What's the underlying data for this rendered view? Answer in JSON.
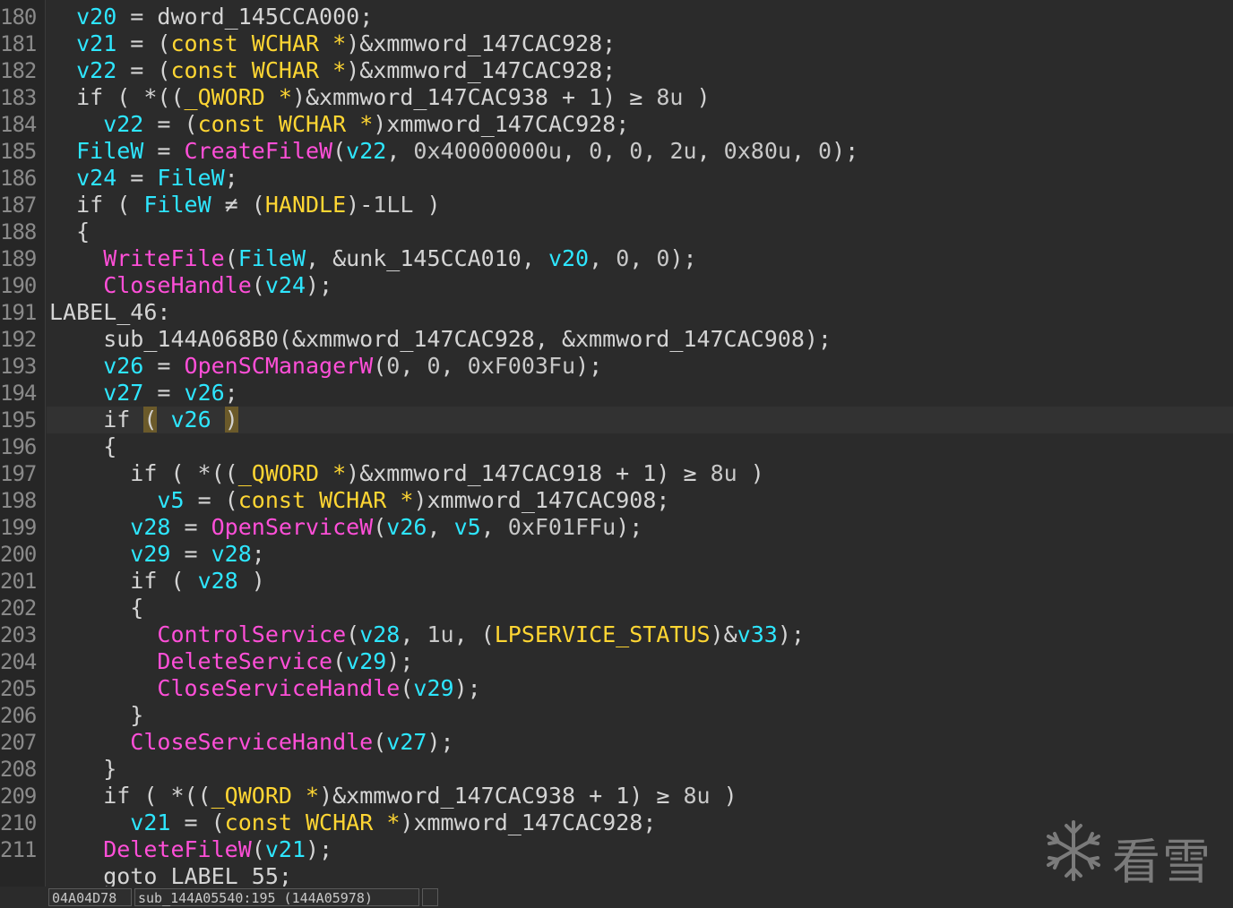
{
  "editor": {
    "current_line": 195,
    "lines": [
      {
        "n": "180",
        "indent": 1,
        "tokens": [
          [
            "v",
            "v20"
          ],
          [
            "p",
            " = "
          ],
          [
            "g",
            "dword_145CCA000"
          ],
          [
            "p",
            ";"
          ]
        ]
      },
      {
        "n": "181",
        "indent": 1,
        "tokens": [
          [
            "v",
            "v21"
          ],
          [
            "p",
            " = ("
          ],
          [
            "t",
            "const"
          ],
          [
            "p",
            " "
          ],
          [
            "t",
            "WCHAR"
          ],
          [
            "p",
            " "
          ],
          [
            "t",
            "*"
          ],
          [
            "p",
            ")&xmmword_147CAC928;"
          ]
        ]
      },
      {
        "n": "182",
        "indent": 1,
        "tokens": [
          [
            "v",
            "v22"
          ],
          [
            "p",
            " = ("
          ],
          [
            "t",
            "const"
          ],
          [
            "p",
            " "
          ],
          [
            "t",
            "WCHAR"
          ],
          [
            "p",
            " "
          ],
          [
            "t",
            "*"
          ],
          [
            "p",
            ")&xmmword_147CAC928;"
          ]
        ]
      },
      {
        "n": "183",
        "indent": 1,
        "tokens": [
          [
            "p",
            "if ( *(("
          ],
          [
            "t",
            "_QWORD"
          ],
          [
            "p",
            " "
          ],
          [
            "t",
            "*"
          ],
          [
            "p",
            ")&xmmword_147CAC938 + 1) "
          ],
          [
            "p",
            "≥"
          ],
          [
            "p",
            " "
          ],
          [
            "n",
            "8u"
          ],
          [
            "p",
            " )"
          ]
        ]
      },
      {
        "n": "184",
        "indent": 2,
        "tokens": [
          [
            "v",
            "v22"
          ],
          [
            "p",
            " = ("
          ],
          [
            "t",
            "const"
          ],
          [
            "p",
            " "
          ],
          [
            "t",
            "WCHAR"
          ],
          [
            "p",
            " "
          ],
          [
            "t",
            "*"
          ],
          [
            "p",
            ")xmmword_147CAC928;"
          ]
        ]
      },
      {
        "n": "185",
        "indent": 1,
        "tokens": [
          [
            "v",
            "FileW"
          ],
          [
            "p",
            " = "
          ],
          [
            "f",
            "CreateFileW"
          ],
          [
            "p",
            "("
          ],
          [
            "v",
            "v22"
          ],
          [
            "p",
            ", "
          ],
          [
            "n",
            "0x40000000u"
          ],
          [
            "p",
            ", "
          ],
          [
            "n",
            "0"
          ],
          [
            "p",
            ", "
          ],
          [
            "n",
            "0"
          ],
          [
            "p",
            ", "
          ],
          [
            "n",
            "2u"
          ],
          [
            "p",
            ", "
          ],
          [
            "n",
            "0x80u"
          ],
          [
            "p",
            ", "
          ],
          [
            "n",
            "0"
          ],
          [
            "p",
            ");"
          ]
        ]
      },
      {
        "n": "186",
        "indent": 1,
        "tokens": [
          [
            "v",
            "v24"
          ],
          [
            "p",
            " = "
          ],
          [
            "v",
            "FileW"
          ],
          [
            "p",
            ";"
          ]
        ]
      },
      {
        "n": "187",
        "indent": 1,
        "tokens": [
          [
            "p",
            "if ( "
          ],
          [
            "v",
            "FileW"
          ],
          [
            "p",
            " ≠ ("
          ],
          [
            "t",
            "HANDLE"
          ],
          [
            "p",
            ")-"
          ],
          [
            "n",
            "1LL"
          ],
          [
            "p",
            " )"
          ]
        ]
      },
      {
        "n": "188",
        "indent": 1,
        "tokens": [
          [
            "p",
            "{"
          ]
        ]
      },
      {
        "n": "189",
        "indent": 2,
        "tokens": [
          [
            "f",
            "WriteFile"
          ],
          [
            "p",
            "("
          ],
          [
            "v",
            "FileW"
          ],
          [
            "p",
            ", &unk_145CCA010, "
          ],
          [
            "v",
            "v20"
          ],
          [
            "p",
            ", "
          ],
          [
            "n",
            "0"
          ],
          [
            "p",
            ", "
          ],
          [
            "n",
            "0"
          ],
          [
            "p",
            ");"
          ]
        ]
      },
      {
        "n": "190",
        "indent": 2,
        "tokens": [
          [
            "f",
            "CloseHandle"
          ],
          [
            "p",
            "("
          ],
          [
            "v",
            "v24"
          ],
          [
            "p",
            ");"
          ]
        ]
      },
      {
        "n": "191",
        "indent": 0,
        "tokens": [
          [
            "p",
            "LABEL_46:"
          ]
        ]
      },
      {
        "n": "192",
        "indent": 2,
        "tokens": [
          [
            "p",
            "sub_144A068B0(&xmmword_147CAC928, &xmmword_147CAC908);"
          ]
        ]
      },
      {
        "n": "193",
        "indent": 2,
        "tokens": [
          [
            "v",
            "v26"
          ],
          [
            "p",
            " = "
          ],
          [
            "f",
            "OpenSCManagerW"
          ],
          [
            "p",
            "("
          ],
          [
            "n",
            "0"
          ],
          [
            "p",
            ", "
          ],
          [
            "n",
            "0"
          ],
          [
            "p",
            ", "
          ],
          [
            "n",
            "0xF003Fu"
          ],
          [
            "p",
            ");"
          ]
        ]
      },
      {
        "n": "194",
        "indent": 2,
        "tokens": [
          [
            "v",
            "v27"
          ],
          [
            "p",
            " = "
          ],
          [
            "v",
            "v26"
          ],
          [
            "p",
            ";"
          ]
        ]
      },
      {
        "n": "195",
        "indent": 2,
        "tokens": [
          [
            "p",
            "if "
          ],
          [
            "h",
            "("
          ],
          [
            "p",
            " "
          ],
          [
            "v",
            "v26"
          ],
          [
            "p",
            " "
          ],
          [
            "h",
            ")"
          ]
        ]
      },
      {
        "n": "196",
        "indent": 2,
        "tokens": [
          [
            "p",
            "{"
          ]
        ]
      },
      {
        "n": "197",
        "indent": 3,
        "tokens": [
          [
            "p",
            "if ( *(("
          ],
          [
            "t",
            "_QWORD"
          ],
          [
            "p",
            " "
          ],
          [
            "t",
            "*"
          ],
          [
            "p",
            ")&xmmword_147CAC918 + 1) "
          ],
          [
            "p",
            "≥"
          ],
          [
            "p",
            " "
          ],
          [
            "n",
            "8u"
          ],
          [
            "p",
            " )"
          ]
        ]
      },
      {
        "n": "198",
        "indent": 4,
        "tokens": [
          [
            "v",
            "v5"
          ],
          [
            "p",
            " = ("
          ],
          [
            "t",
            "const"
          ],
          [
            "p",
            " "
          ],
          [
            "t",
            "WCHAR"
          ],
          [
            "p",
            " "
          ],
          [
            "t",
            "*"
          ],
          [
            "p",
            ")xmmword_147CAC908;"
          ]
        ]
      },
      {
        "n": "199",
        "indent": 3,
        "tokens": [
          [
            "v",
            "v28"
          ],
          [
            "p",
            " = "
          ],
          [
            "f",
            "OpenServiceW"
          ],
          [
            "p",
            "("
          ],
          [
            "v",
            "v26"
          ],
          [
            "p",
            ", "
          ],
          [
            "v",
            "v5"
          ],
          [
            "p",
            ", "
          ],
          [
            "n",
            "0xF01FFu"
          ],
          [
            "p",
            ");"
          ]
        ]
      },
      {
        "n": "200",
        "indent": 3,
        "tokens": [
          [
            "v",
            "v29"
          ],
          [
            "p",
            " = "
          ],
          [
            "v",
            "v28"
          ],
          [
            "p",
            ";"
          ]
        ]
      },
      {
        "n": "201",
        "indent": 3,
        "tokens": [
          [
            "p",
            "if ( "
          ],
          [
            "v",
            "v28"
          ],
          [
            "p",
            " )"
          ]
        ]
      },
      {
        "n": "202",
        "indent": 3,
        "tokens": [
          [
            "p",
            "{"
          ]
        ]
      },
      {
        "n": "203",
        "indent": 4,
        "tokens": [
          [
            "f",
            "ControlService"
          ],
          [
            "p",
            "("
          ],
          [
            "v",
            "v28"
          ],
          [
            "p",
            ", "
          ],
          [
            "n",
            "1u"
          ],
          [
            "p",
            ", ("
          ],
          [
            "t",
            "LPSERVICE_STATUS"
          ],
          [
            "p",
            ")&"
          ],
          [
            "v",
            "v33"
          ],
          [
            "p",
            ");"
          ]
        ]
      },
      {
        "n": "204",
        "indent": 4,
        "tokens": [
          [
            "f",
            "DeleteService"
          ],
          [
            "p",
            "("
          ],
          [
            "v",
            "v29"
          ],
          [
            "p",
            ");"
          ]
        ]
      },
      {
        "n": "205",
        "indent": 4,
        "tokens": [
          [
            "f",
            "CloseServiceHandle"
          ],
          [
            "p",
            "("
          ],
          [
            "v",
            "v29"
          ],
          [
            "p",
            ");"
          ]
        ]
      },
      {
        "n": "206",
        "indent": 3,
        "tokens": [
          [
            "p",
            "}"
          ]
        ]
      },
      {
        "n": "207",
        "indent": 3,
        "tokens": [
          [
            "f",
            "CloseServiceHandle"
          ],
          [
            "p",
            "("
          ],
          [
            "v",
            "v27"
          ],
          [
            "p",
            ");"
          ]
        ]
      },
      {
        "n": "208",
        "indent": 2,
        "tokens": [
          [
            "p",
            "}"
          ]
        ]
      },
      {
        "n": "209",
        "indent": 2,
        "tokens": [
          [
            "p",
            "if ( *(("
          ],
          [
            "t",
            "_QWORD"
          ],
          [
            "p",
            " "
          ],
          [
            "t",
            "*"
          ],
          [
            "p",
            ")&xmmword_147CAC938 + 1) "
          ],
          [
            "p",
            "≥"
          ],
          [
            "p",
            " "
          ],
          [
            "n",
            "8u"
          ],
          [
            "p",
            " )"
          ]
        ]
      },
      {
        "n": "210",
        "indent": 3,
        "tokens": [
          [
            "v",
            "v21"
          ],
          [
            "p",
            " = ("
          ],
          [
            "t",
            "const"
          ],
          [
            "p",
            " "
          ],
          [
            "t",
            "WCHAR"
          ],
          [
            "p",
            " "
          ],
          [
            "t",
            "*"
          ],
          [
            "p",
            ")xmmword_147CAC928;"
          ]
        ]
      },
      {
        "n": "211",
        "indent": 2,
        "tokens": [
          [
            "f",
            "DeleteFileW"
          ],
          [
            "p",
            "("
          ],
          [
            "v",
            "v21"
          ],
          [
            "p",
            ");"
          ]
        ]
      },
      {
        "n": "",
        "indent": 2,
        "tokens": [
          [
            "p",
            "goto LABEL_55;"
          ]
        ]
      }
    ]
  },
  "statusbar": {
    "address": "04A04D78",
    "location": "sub_144A05540:195 (144A05978)",
    "extra": ""
  },
  "watermark": {
    "text": "看雪",
    "icon": "snowflake-icon"
  }
}
